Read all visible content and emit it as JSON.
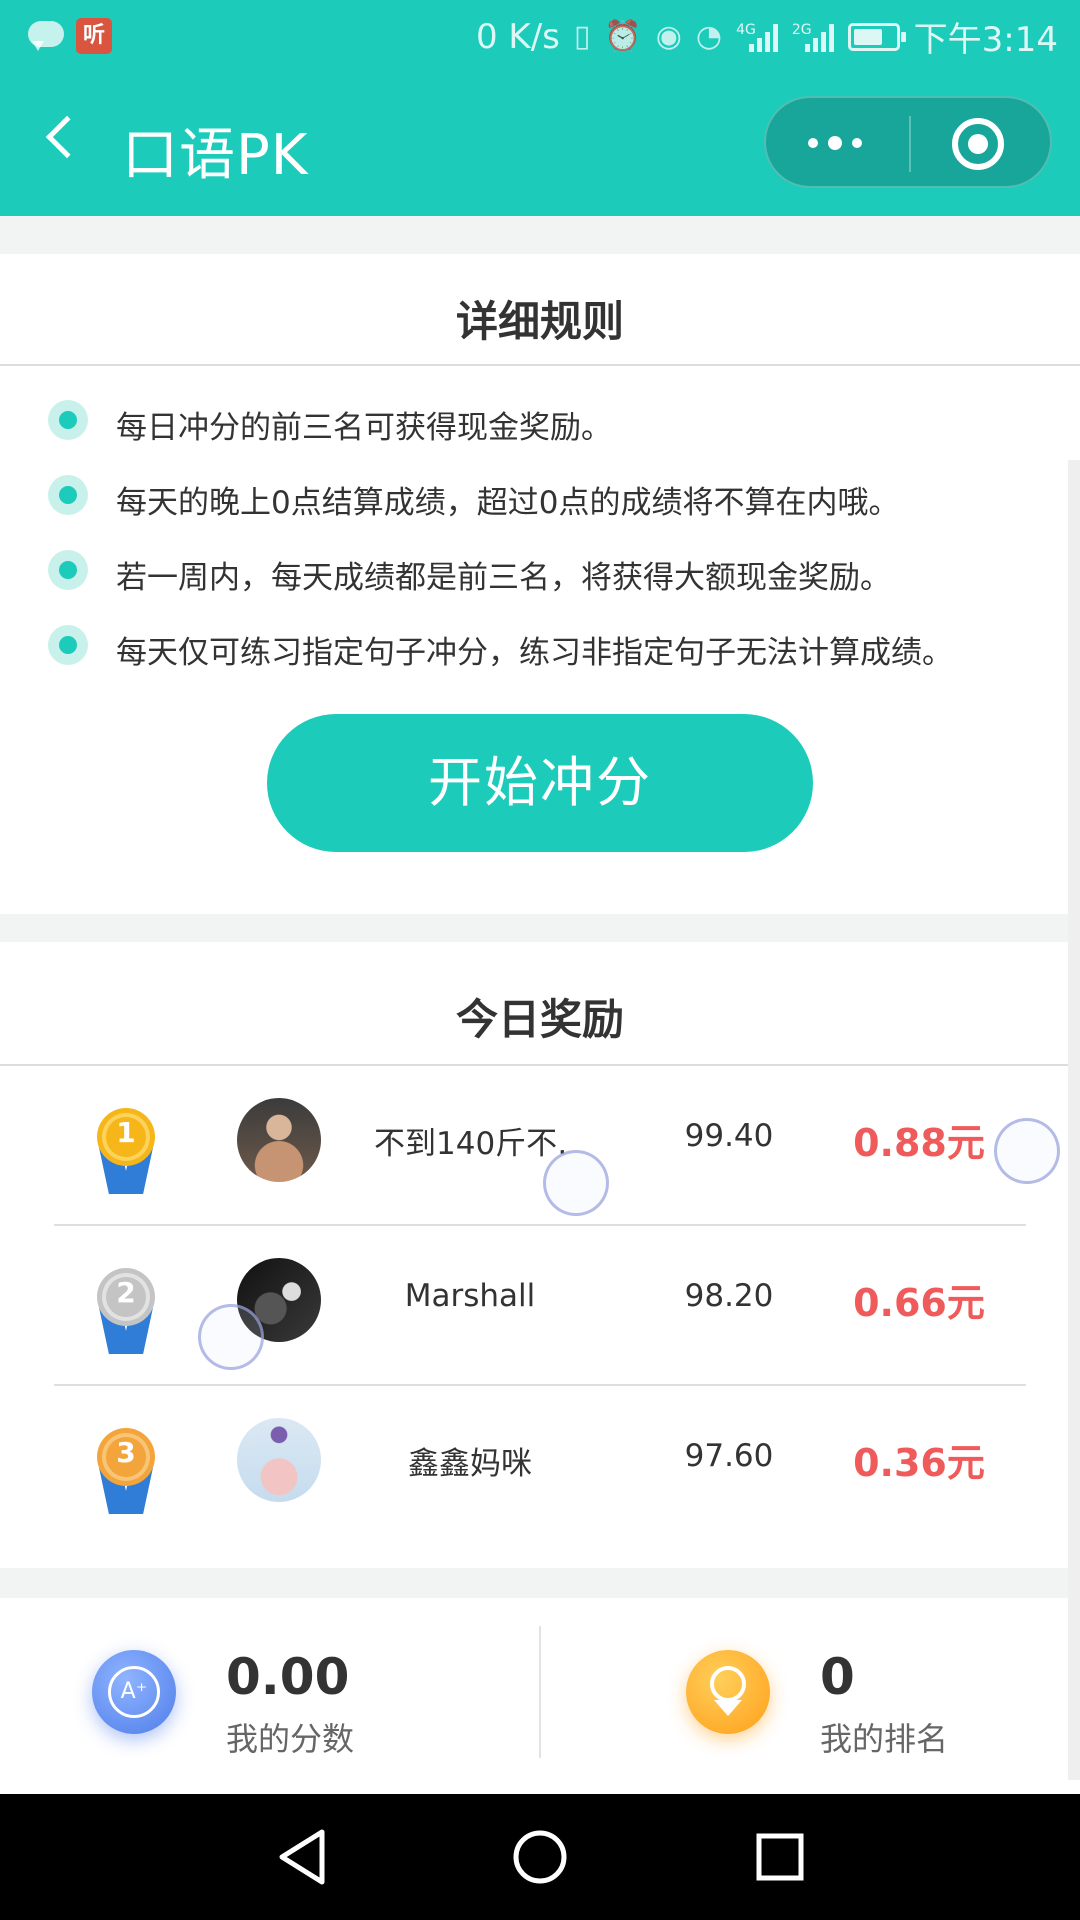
{
  "status_bar": {
    "speed": "0 K/s",
    "time": "下午3:14",
    "ting_label": "听",
    "signal_tag_1": "4G",
    "signal_tag_2": "2G"
  },
  "nav": {
    "title": "口语PK"
  },
  "rules": {
    "title": "详细规则",
    "items": [
      "每日冲分的前三名可获得现金奖励。",
      "每天的晚上0点结算成绩，超过0点的成绩将不算在内哦。",
      "若一周内，每天成绩都是前三名，将获得大额现金奖励。",
      "每天仅可练习指定句子冲分，练习非指定句子无法计算成绩。"
    ],
    "start_button": "开始冲分"
  },
  "reward": {
    "title": "今日奖励",
    "rows": [
      {
        "rank": "1",
        "medal_color": "#f6b619",
        "name": "不到140斤不…",
        "score": "99.40",
        "reward": "0.88元"
      },
      {
        "rank": "2",
        "medal_color": "#c4c4c4",
        "name": "Marshall",
        "score": "98.20",
        "reward": "0.66元"
      },
      {
        "rank": "3",
        "medal_color": "#f3a53b",
        "name": "鑫鑫妈咪",
        "score": "97.60",
        "reward": "0.36元"
      }
    ]
  },
  "mine": {
    "score_value": "0.00",
    "score_label": "我的分数",
    "rank_value": "0",
    "rank_label": "我的排名",
    "score_icon_text": "A⁺"
  },
  "colors": {
    "accent": "#1dcbbb",
    "reward_red": "#ef5b5b"
  }
}
